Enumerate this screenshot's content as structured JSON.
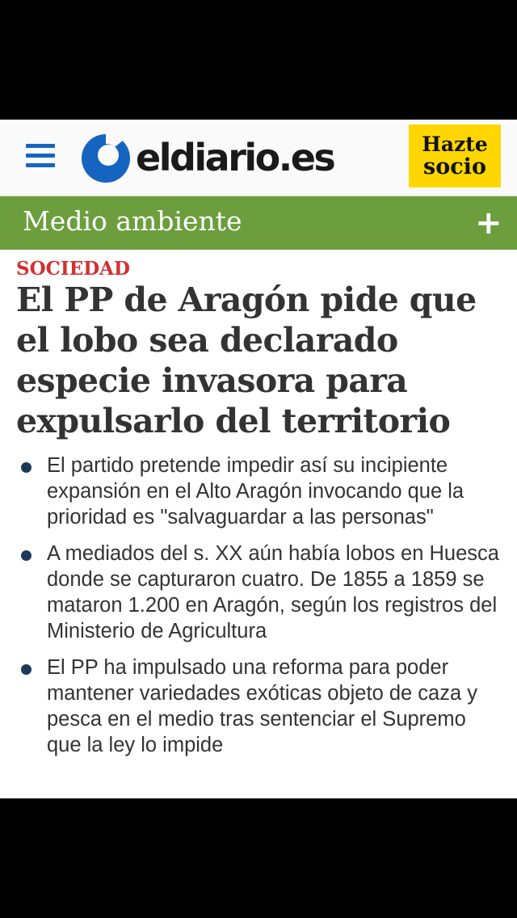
{
  "header": {
    "logo_text": "eldiario.es",
    "socio_line1": "Hazte",
    "socio_line2": "socio"
  },
  "section": {
    "title": "Medio ambiente",
    "expand_symbol": "+"
  },
  "article": {
    "kicker": "SOCIEDAD",
    "headline": "El PP de Aragón pide que el lobo sea declarado especie invasora para expulsarlo del territorio",
    "summary": [
      "El partido pretende impedir así su incipiente expansión en el Alto Aragón invocando que la prioridad es \"salvaguardar a las personas\"",
      "A mediados del s. XX aún había lobos en Huesca donde se capturaron cuatro. De 1855 a 1859 se mataron 1.200 en Aragón, según los registros del Ministerio de Agricultura",
      "El PP ha impulsado una reforma para poder mantener variedades exóticas objeto de caza y pesca en el medio tras sentenciar el Supremo que la ley lo impide"
    ]
  },
  "icons": {
    "menu": "hamburger-menu-icon",
    "logo": "eldiario-logo-icon",
    "expand": "plus-icon",
    "bullet": "bullet-dot-icon"
  },
  "colors": {
    "brand_blue": "#1565c0",
    "socio_yellow": "#ffd600",
    "section_green": "#6c9e3e",
    "kicker_red": "#d32f2f",
    "bullet_navy": "#1b3a57"
  }
}
